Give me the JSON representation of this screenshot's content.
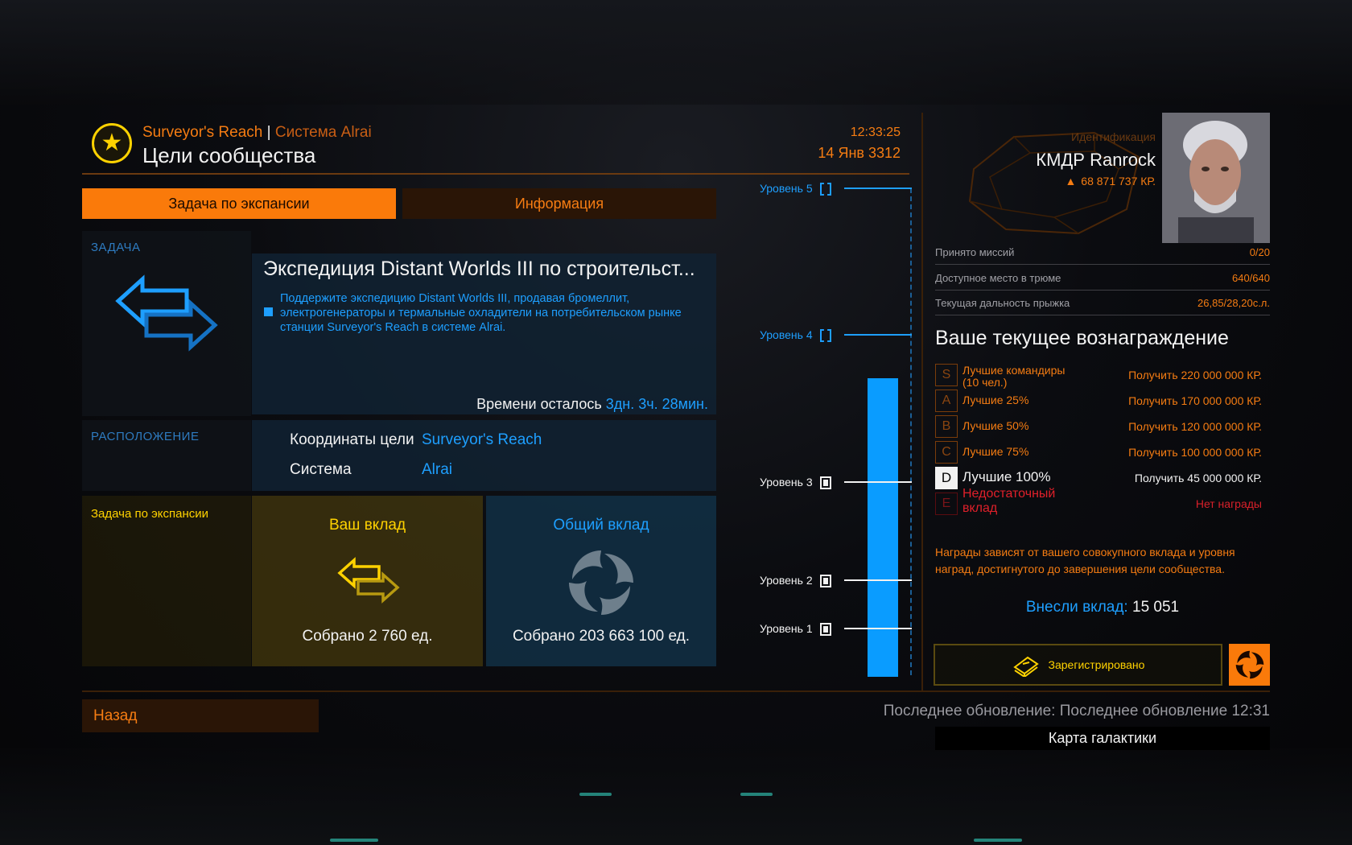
{
  "header": {
    "station": "Surveyor's Reach",
    "separator": "|",
    "system": "Система Alrai",
    "title": "Цели сообщества",
    "time": "12:33:25",
    "date": "14 Янв 3312"
  },
  "tabs": [
    {
      "label": "Задача по экспансии",
      "active": true
    },
    {
      "label": "Информация",
      "active": false
    }
  ],
  "task": {
    "section_label": "ЗАДАЧА",
    "title": "Экспедиция Distant Worlds III по строительст...",
    "description": "Поддержите экспедицию Distant Worlds III, продавая бромеллит, электрогенераторы и термальные охладители на потребительском рынке станции Surveyor's Reach в системе Alrai.",
    "time_left_label": "Времени осталось",
    "time_left_value": "3дн. 3ч. 28мин."
  },
  "location": {
    "section_label": "РАСПОЛОЖЕНИЕ",
    "target_label": "Координаты цели",
    "target_value": "Surveyor's Reach",
    "system_label": "Система",
    "system_value": "Alrai"
  },
  "contribution": {
    "section_label": "Задача по экспансии",
    "yours_label": "Ваш вклад",
    "yours_value": "Собрано 2 760 ед.",
    "total_label": "Общий вклад",
    "total_value": "Собрано 203 663 100 ед."
  },
  "levels": {
    "items": [
      "Уровень 5",
      "Уровень 4",
      "Уровень 3",
      "Уровень 2",
      "Уровень 1"
    ],
    "progress_fraction": 0.61
  },
  "commander": {
    "id_label": "Идентификация",
    "name": "КМДР Ranrock",
    "credits": "68 871 737 КР."
  },
  "stats": [
    {
      "label": "Принято миссий",
      "value": "0/20"
    },
    {
      "label": "Доступное место в трюме",
      "value": "640/640"
    },
    {
      "label": "Текущая дальность прыжка",
      "value": "26,85/28,20с.л."
    }
  ],
  "rewards": {
    "title": "Ваше текущее вознаграждение",
    "tiers": [
      {
        "grade": "S",
        "label": "Лучшие командиры (10 чел.)",
        "reward": "Получить 220 000 000 КР."
      },
      {
        "grade": "A",
        "label": "Лучшие 25%",
        "reward": "Получить 170 000 000 КР."
      },
      {
        "grade": "B",
        "label": "Лучшие 50%",
        "reward": "Получить 120 000 000 КР."
      },
      {
        "grade": "C",
        "label": "Лучшие 75%",
        "reward": "Получить 100 000 000 КР."
      },
      {
        "grade": "D",
        "label": "Лучшие 100%",
        "reward": "Получить 45 000 000 КР."
      },
      {
        "grade": "E",
        "label": "Недостаточный вклад",
        "reward": "Нет награды"
      }
    ],
    "note": "Награды зависят от вашего совокупного вклада и уровня наград, достигнутого до завершения цели сообщества.",
    "contributed_label": "Внесли вклад:",
    "contributed_value": "15 051",
    "registered_label": "Зарегистрировано"
  },
  "footer": {
    "back_label": "Назад",
    "last_update": "Последнее обновление: Последнее обновление 12:31",
    "galaxy_map_label": "Карта галактики"
  },
  "colors": {
    "accent": "#fa7a0a",
    "info_blue": "#1e9fff",
    "gold": "#ffd200",
    "warning_red": "#e0202a"
  }
}
